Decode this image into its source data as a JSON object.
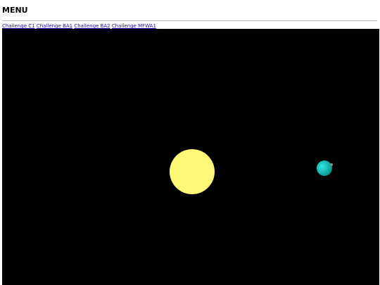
{
  "page": {
    "heading": "MENU"
  },
  "nav": {
    "links": [
      {
        "label": "Challenge C1"
      },
      {
        "label": "Challenge BA1"
      },
      {
        "label": "Challenge BA2"
      },
      {
        "label": "Challenge MFWA1"
      }
    ]
  },
  "scene": {
    "background_color": "#000000",
    "sun_color": "#fff977",
    "planet_color_light": "#2ee8e0",
    "planet_color_dark": "#0a8f8a",
    "moon_color": "#8a8a8a",
    "link_color": "#1a0dab"
  }
}
